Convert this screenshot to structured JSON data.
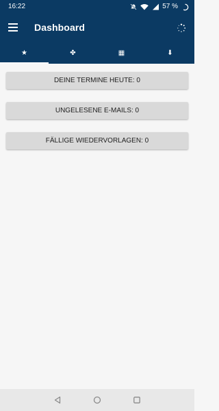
{
  "status_bar": {
    "time": "16:22",
    "battery_text": "57 %"
  },
  "app_bar": {
    "title": "Dashboard",
    "menu_icon": "hamburger-menu-icon",
    "refresh_icon": "refresh-icon"
  },
  "tabs": [
    {
      "icon": "star-icon",
      "glyph": "★",
      "active": true
    },
    {
      "icon": "people-icon",
      "glyph": "✤",
      "active": false
    },
    {
      "icon": "calendar-icon",
      "glyph": "▦",
      "active": false
    },
    {
      "icon": "inbox-icon",
      "glyph": "⬇",
      "active": false
    }
  ],
  "dashboard": {
    "items": [
      {
        "label": "DEINE TERMINE HEUTE: 0"
      },
      {
        "label": "UNGELESENE E-MAILS: 0"
      },
      {
        "label": "FÄLLIGE WIEDERVORLAGEN: 0"
      }
    ]
  },
  "colors": {
    "primary": "#0b3a63",
    "background": "#f6f6f6",
    "button": "#d9d9d9"
  }
}
